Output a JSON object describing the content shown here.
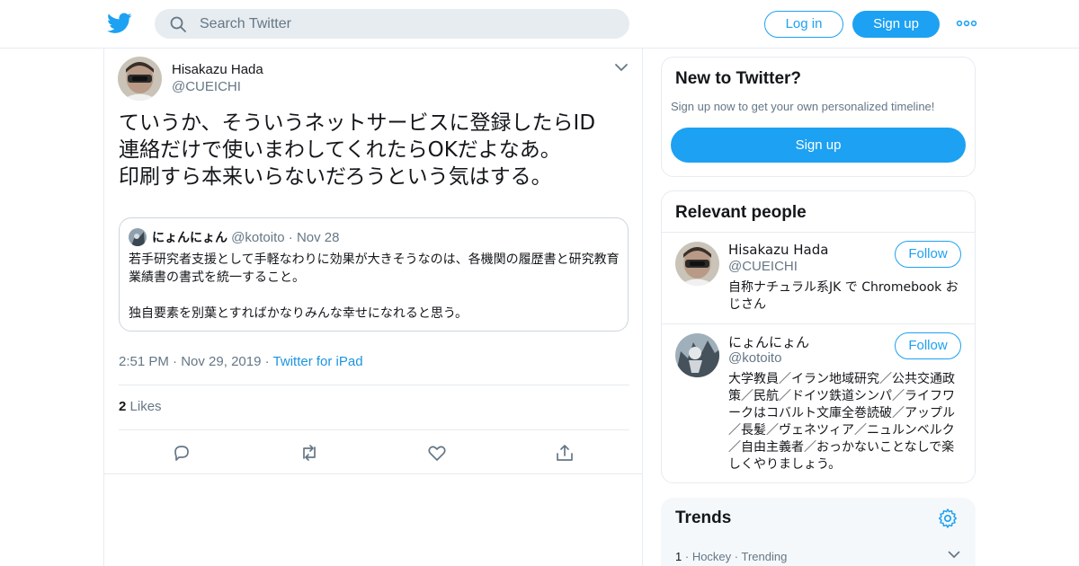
{
  "header": {
    "search_placeholder": "Search Twitter",
    "login_label": "Log in",
    "signup_label": "Sign up"
  },
  "tweet": {
    "author_name": "Hisakazu Hada",
    "author_handle": "@CUEICHI",
    "text": "ていうか、そういうネットサービスに登録したらID\n連絡だけで使いまわしてくれたらOKだよなあ。\n印刷すら本来いらないだろうという気はする。",
    "quoted": {
      "name": "にょんにょん",
      "handle": "@kotoito",
      "date": "Nov 28",
      "text": "若手研究者支援として手軽なわりに効果が大きそうなのは、各機関の履歴書と研究教育業績書の書式を統一すること。\n\n独自要素を別葉とすればかなりみんな幸せになれると思う。"
    },
    "time": "2:51 PM",
    "date": "Nov 29, 2019",
    "source": "Twitter for iPad",
    "likes_count": "2",
    "likes_label": "Likes"
  },
  "sidebar": {
    "new_to_twitter": {
      "title": "New to Twitter?",
      "subtitle": "Sign up now to get your own personalized timeline!",
      "button": "Sign up"
    },
    "relevant_people": {
      "title": "Relevant people",
      "people": [
        {
          "name": "Hisakazu Hada",
          "handle": "@CUEICHI",
          "bio": "自称ナチュラル系JK で Chromebook おじさん",
          "follow_label": "Follow"
        },
        {
          "name": "にょんにょん",
          "handle": "@kotoito",
          "bio": "大学教員／イラン地域研究／公共交通政策／民航／ドイツ鉄道シンパ／ライフワークはコバルト文庫全巻読破／アップル／長髪／ヴェネツィア／ニュルンベルク／自由主義者／おっかないことなしで楽しくやりましょう。",
          "follow_label": "Follow"
        }
      ]
    },
    "trends": {
      "title": "Trends",
      "items": [
        {
          "rank": "1",
          "topic": "Hockey",
          "status": "Trending"
        }
      ]
    }
  },
  "colors": {
    "accent": "#1da1f2",
    "link": "#1b95e0",
    "muted": "#657786",
    "border": "#e6ecf0"
  }
}
